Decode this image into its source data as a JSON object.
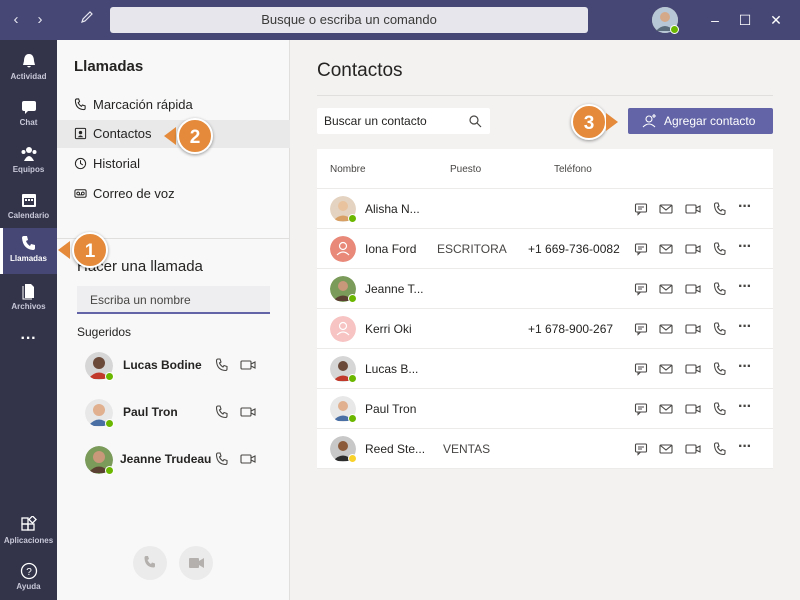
{
  "titlebar": {
    "search_placeholder": "Busque o escriba un comando"
  },
  "rail": {
    "items": [
      {
        "label": "Actividad",
        "icon": "bell-icon"
      },
      {
        "label": "Chat",
        "icon": "chat-icon"
      },
      {
        "label": "Equipos",
        "icon": "teams-icon"
      },
      {
        "label": "Calendario",
        "icon": "calendar-icon"
      },
      {
        "label": "Llamadas",
        "icon": "phone-icon"
      },
      {
        "label": "Archivos",
        "icon": "file-icon"
      },
      {
        "label": "Aplicaciones",
        "icon": "apps-icon"
      },
      {
        "label": "Ayuda",
        "icon": "help-icon"
      }
    ],
    "more": "···"
  },
  "leftpane": {
    "title": "Llamadas",
    "nav": [
      "Marcación rápida",
      "Contactos",
      "Historial",
      "Correo de voz"
    ],
    "make_call_title": "Hacer una llamada",
    "name_placeholder": "Escriba un nombre",
    "suggested_label": "Sugeridos",
    "suggested": [
      "Lucas Bodine",
      "Paul Tron",
      "Jeanne Trudeau"
    ]
  },
  "main": {
    "title": "Contactos",
    "search_placeholder": "Buscar un contacto",
    "add_button": "Agregar contacto",
    "columns": [
      "Nombre",
      "Puesto",
      "Teléfono"
    ],
    "contacts": [
      {
        "name": "Alisha N...",
        "title": "",
        "phone": ""
      },
      {
        "name": "Iona Ford",
        "title": "ESCRITORA",
        "phone": "+1 669-736-0082"
      },
      {
        "name": "Jeanne T...",
        "title": "",
        "phone": ""
      },
      {
        "name": "Kerri Oki",
        "title": "",
        "phone": "+1 678-900-267"
      },
      {
        "name": "Lucas B...",
        "title": "",
        "phone": ""
      },
      {
        "name": "Paul Tron",
        "title": "",
        "phone": ""
      },
      {
        "name": "Reed Ste...",
        "title": "VENTAS",
        "phone": ""
      }
    ],
    "more_actions": "···"
  },
  "callouts": [
    "1",
    "2",
    "3"
  ],
  "colors": {
    "accent": "#6264a7",
    "rail": "#33344a",
    "titlebar": "#464775",
    "callout": "#e48a3a"
  }
}
